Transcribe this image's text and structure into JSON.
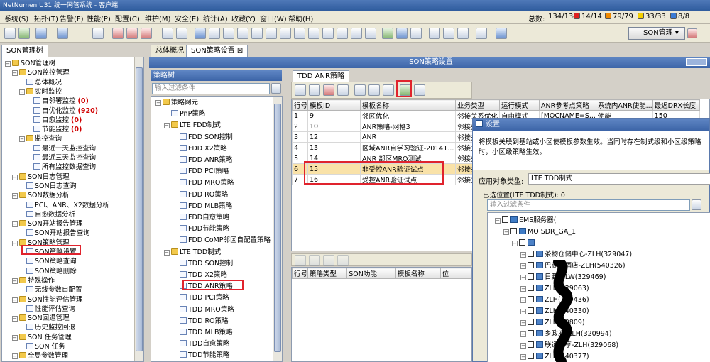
{
  "window": {
    "title": "NetNumen U31 统一网管系统 - 客户端"
  },
  "menus": [
    "系统(S)",
    "拓扑(T)",
    "告警(F)",
    "性能(P)",
    "配置(C)",
    "维护(M)",
    "安全(E)",
    "统计(A)",
    "收藏(Y)",
    "窗口(W)",
    "帮助(H)"
  ],
  "status": {
    "total_label": "总数:",
    "total_value": "134/134",
    "s1": "14/14",
    "s2": "79/79",
    "s3": "33/33",
    "s4": "8/8",
    "colors": {
      "s1": "#e02020",
      "s2": "#f08a00",
      "s3": "#f4d000",
      "s4": "#3a7bd5"
    }
  },
  "toolbar": {
    "son_button": "SON管理"
  },
  "left_tree": {
    "tab": "SON管理树",
    "items": [
      {
        "t": "SON管理树",
        "lvl": 0,
        "icon": "folder"
      },
      {
        "t": "SON监控管理",
        "lvl": 1,
        "icon": "folder"
      },
      {
        "t": "总体概况",
        "lvl": 2,
        "icon": "doc"
      },
      {
        "t": "实时监控",
        "lvl": 2,
        "icon": "folder"
      },
      {
        "t": "自邻署监控",
        "lvl": 3,
        "icon": "doc",
        "badge": "(0)"
      },
      {
        "t": "自优化监控",
        "lvl": 3,
        "icon": "doc",
        "badge": "(920)"
      },
      {
        "t": "自愈监控",
        "lvl": 3,
        "icon": "doc",
        "badge": "(0)"
      },
      {
        "t": "节能监控",
        "lvl": 3,
        "icon": "doc",
        "badge": "(0)"
      },
      {
        "t": "监控查询",
        "lvl": 2,
        "icon": "folder"
      },
      {
        "t": "最近一天监控查询",
        "lvl": 3,
        "icon": "doc"
      },
      {
        "t": "最近三天监控查询",
        "lvl": 3,
        "icon": "doc"
      },
      {
        "t": "所有监控数据查询",
        "lvl": 3,
        "icon": "doc"
      },
      {
        "t": "SON日志管理",
        "lvl": 1,
        "icon": "folder"
      },
      {
        "t": "SON日志查询",
        "lvl": 2,
        "icon": "doc"
      },
      {
        "t": "SON数据分析",
        "lvl": 1,
        "icon": "folder"
      },
      {
        "t": "PCI、ANR、X2数据分析",
        "lvl": 2,
        "icon": "doc"
      },
      {
        "t": "自愈数据分析",
        "lvl": 2,
        "icon": "doc"
      },
      {
        "t": "SON开站报告管理",
        "lvl": 1,
        "icon": "folder"
      },
      {
        "t": "SON开站报告查询",
        "lvl": 2,
        "icon": "doc"
      },
      {
        "t": "SON策略管理",
        "lvl": 1,
        "icon": "folder"
      },
      {
        "t": "SON策略设置",
        "lvl": 2,
        "icon": "doc"
      },
      {
        "t": "SON策略查询",
        "lvl": 2,
        "icon": "doc"
      },
      {
        "t": "SON策略删除",
        "lvl": 2,
        "icon": "doc"
      },
      {
        "t": "特殊操作",
        "lvl": 1,
        "icon": "folder"
      },
      {
        "t": "无线参数自配置",
        "lvl": 2,
        "icon": "doc"
      },
      {
        "t": "SON性能评估管理",
        "lvl": 1,
        "icon": "folder"
      },
      {
        "t": "性能评估查询",
        "lvl": 2,
        "icon": "doc"
      },
      {
        "t": "SON回退管理",
        "lvl": 1,
        "icon": "folder"
      },
      {
        "t": "历史监控回退",
        "lvl": 2,
        "icon": "doc"
      },
      {
        "t": "SON 任务管理",
        "lvl": 1,
        "icon": "folder"
      },
      {
        "t": "SON 任务",
        "lvl": 2,
        "icon": "doc"
      },
      {
        "t": "全局参数管理",
        "lvl": 1,
        "icon": "folder"
      },
      {
        "t": "全局参数管理",
        "lvl": 2,
        "icon": "doc"
      }
    ]
  },
  "doc_tabs": {
    "tab1": "总体概况",
    "tab2": "SON策略设置 ⊠"
  },
  "policy_header": "SON策略设置",
  "policy_tree": {
    "title": "策略树",
    "filter_placeholder": "输入过滤条件",
    "items": [
      {
        "t": "策略网元",
        "lvl": 0,
        "icon": "folder"
      },
      {
        "t": "PnP策略",
        "lvl": 1,
        "icon": "doc"
      },
      {
        "t": "LTE FDD制式",
        "lvl": 1,
        "icon": "folder"
      },
      {
        "t": "FDD SON控制",
        "lvl": 2,
        "icon": "doc"
      },
      {
        "t": "FDD X2策略",
        "lvl": 2,
        "icon": "doc"
      },
      {
        "t": "FDD ANR策略",
        "lvl": 2,
        "icon": "doc"
      },
      {
        "t": "FDD PCI策略",
        "lvl": 2,
        "icon": "doc"
      },
      {
        "t": "FDD MRO策略",
        "lvl": 2,
        "icon": "doc"
      },
      {
        "t": "FDD RO策略",
        "lvl": 2,
        "icon": "doc"
      },
      {
        "t": "FDD MLB策略",
        "lvl": 2,
        "icon": "doc"
      },
      {
        "t": "FDD自愈策略",
        "lvl": 2,
        "icon": "doc"
      },
      {
        "t": "FDD节能策略",
        "lvl": 2,
        "icon": "doc"
      },
      {
        "t": "FDD CoMP邻区自配置策略",
        "lvl": 2,
        "icon": "doc"
      },
      {
        "t": "LTE TDD制式",
        "lvl": 1,
        "icon": "folder"
      },
      {
        "t": "TDD SON控制",
        "lvl": 2,
        "icon": "doc"
      },
      {
        "t": "TDD X2策略",
        "lvl": 2,
        "icon": "doc"
      },
      {
        "t": "TDD ANR策略",
        "lvl": 2,
        "icon": "doc"
      },
      {
        "t": "TDD PCI策略",
        "lvl": 2,
        "icon": "doc"
      },
      {
        "t": "TDD MRO策略",
        "lvl": 2,
        "icon": "doc"
      },
      {
        "t": "TDD RO策略",
        "lvl": 2,
        "icon": "doc"
      },
      {
        "t": "TDD MLB策略",
        "lvl": 2,
        "icon": "doc"
      },
      {
        "t": "TDD自愈策略",
        "lvl": 2,
        "icon": "doc"
      },
      {
        "t": "TDD节能策略",
        "lvl": 2,
        "icon": "doc"
      }
    ]
  },
  "anr": {
    "tab": "TDD ANR策略",
    "columns": [
      "行号",
      "模板ID",
      "模板名称",
      "业务类型",
      "运行模式",
      "ANR参考点策略",
      "系统内ANR使能...",
      "最迟DRX长度"
    ],
    "rows": [
      [
        "1",
        "9",
        "邻区优化",
        "邻接关系优化",
        "自由模式",
        "[MOCNAME=S...",
        "使能",
        "150"
      ],
      [
        "2",
        "10",
        "ANR策略-网格3",
        "邻接关",
        "",
        "",
        "",
        ""
      ],
      [
        "3",
        "12",
        "ANR",
        "邻接关",
        "",
        "",
        "",
        ""
      ],
      [
        "4",
        "13",
        "区域ANR自学习验证-20141...",
        "邻接关",
        "",
        "",
        "",
        ""
      ],
      [
        "5",
        "14",
        "ANR 部区MRO测试",
        "邻接关",
        "",
        "",
        "",
        ""
      ],
      [
        "6",
        "15",
        "非受控ANR验证试点",
        "邻接关",
        "",
        "",
        "",
        ""
      ],
      [
        "7",
        "16",
        "受控ANR验证试点",
        "邻接关",
        "",
        "",
        "",
        ""
      ]
    ],
    "sub_columns": [
      "行号",
      "策略类型",
      "SON功能",
      "模板名称",
      "位"
    ]
  },
  "dialog": {
    "title": "设置",
    "description": "将模板关联到基站或小区使模板参数生效。当同时存在制式级和小区级策略时，小区级策略生效。",
    "apply_label": "应用对象类型:",
    "apply_value": "LTE TDD制式",
    "selected_label": "已选位置(LTE TDD制式): 0",
    "filter_placeholder": "输入过滤条件",
    "tree": [
      {
        "t": "EMS服务器(",
        "lvl": 0,
        "icon": "mon"
      },
      {
        "t": "MO SDR_GA_1",
        "lvl": 1,
        "icon": "mon"
      },
      {
        "t": "",
        "lvl": 2,
        "icon": "pc"
      },
      {
        "t": "茶物仓储中心-ZLH(329047)",
        "lvl": 3,
        "icon": "pc"
      },
      {
        "t": "巴商务酒店-ZLH(540326)",
        "lvl": 3,
        "icon": "pc"
      },
      {
        "t": "日野-ZLW(329469)",
        "lvl": 3,
        "icon": "pc"
      },
      {
        "t": "ZLH(329063)",
        "lvl": 3,
        "icon": "pc"
      },
      {
        "t": "ZLH(329436)",
        "lvl": 3,
        "icon": "pc"
      },
      {
        "t": "ZLH(540330)",
        "lvl": 3,
        "icon": "pc"
      },
      {
        "t": "ZLH(40809)",
        "lvl": 3,
        "icon": "pc"
      },
      {
        "t": "乡政府-ZLH(320994)",
        "lvl": 3,
        "icon": "pc"
      },
      {
        "t": "联通共享-ZLH(329068)",
        "lvl": 3,
        "icon": "pc"
      },
      {
        "t": "ZLH(540377)",
        "lvl": 3,
        "icon": "pc"
      }
    ]
  }
}
